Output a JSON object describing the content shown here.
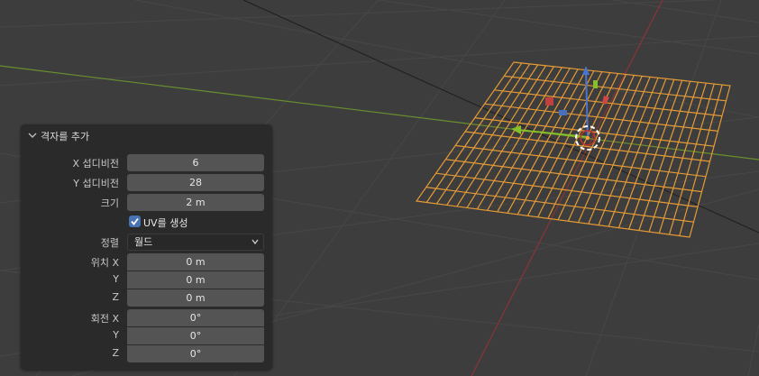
{
  "panel": {
    "title": "격자를 추가",
    "x_subdivisions": {
      "label": "X 섭디비전",
      "value": "6"
    },
    "y_subdivisions": {
      "label": "Y 섭디비전",
      "value": "28"
    },
    "size": {
      "label": "크기",
      "value": "2 m"
    },
    "generate_uvs": {
      "label": "UV를 생성",
      "checked": true
    },
    "align": {
      "label": "정렬",
      "value": "월드"
    },
    "location": {
      "label_x": "위치 X",
      "label_y": "Y",
      "label_z": "Z",
      "x": "0 m",
      "y": "0 m",
      "z": "0 m"
    },
    "rotation": {
      "label_x": "회전 X",
      "label_y": "Y",
      "label_z": "Z",
      "x": "0°",
      "y": "0°",
      "z": "0°"
    }
  },
  "colors": {
    "viewport_bg": "#3d3d3d",
    "grid_line": "#474747",
    "x_axis": "#8b3434",
    "y_axis": "#6a8f2e",
    "mesh_wire": "#e59a35",
    "checkbox": "#4772b3"
  },
  "icons": {
    "panel_toggle": "chevron-down-icon",
    "dropdown": "chevron-down-icon",
    "check": "checkmark-icon",
    "gizmo": "transform-gizmo-icon",
    "cursor": "3d-cursor-icon"
  }
}
